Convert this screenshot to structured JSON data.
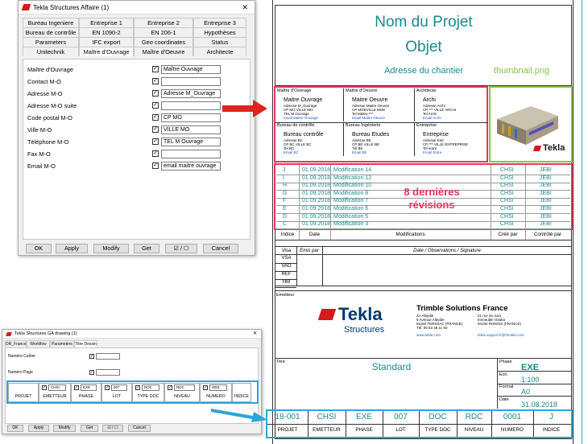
{
  "dialog1": {
    "title": "Tekla Structures  Affaire (1)",
    "close_glyph": "✕",
    "tab_rows": [
      [
        "Bureau Ingeniere",
        "Entreprise 1",
        "Entreprise 2",
        "Entreprise 3"
      ],
      [
        "Bureau de contrôle",
        "EN 1090-2",
        "EN 206-1",
        "Hypothèses"
      ],
      [
        "Parameters",
        "IFC export",
        "Geo coordinates",
        "Status"
      ],
      [
        "Unitechnik",
        "Maître d'Ouvrage",
        "Maître d'Oeuvre",
        "Architecte"
      ]
    ],
    "fields": [
      {
        "label": "Maître d'Ouvrage",
        "checked": true,
        "value": "Maître Ouvrage"
      },
      {
        "label": "Contact M-O",
        "checked": true,
        "value": ""
      },
      {
        "label": "Adresse M-O",
        "checked": true,
        "value": "Adresse M_Ouvrage"
      },
      {
        "label": "Adresse M-O suite",
        "checked": true,
        "value": ""
      },
      {
        "label": "Code postal M-O",
        "checked": true,
        "value": "CP MO"
      },
      {
        "label": "Ville M-O",
        "checked": true,
        "value": "VILLE MO"
      },
      {
        "label": "Téléphone M-O",
        "checked": true,
        "value": "TEL M Ouvrage"
      },
      {
        "label": "Fax M-O",
        "checked": true,
        "value": ""
      },
      {
        "label": "Email M-O",
        "checked": true,
        "value": "email maitre ouvrage"
      }
    ],
    "buttons": {
      "ok": "OK",
      "apply": "Apply",
      "modify": "Modify",
      "get": "Get",
      "toggle": "☑ / ☐",
      "cancel": "Cancel"
    }
  },
  "dialog2": {
    "title": "Tekla Structures  GA drawing (1)",
    "tabs": [
      "DR_France",
      "Workflow",
      "Parameters",
      "Titre Dessin"
    ],
    "fields": [
      {
        "label": "Numéro Cahier",
        "checked": true
      },
      {
        "label": "Numéro Page",
        "checked": true
      }
    ],
    "row_values": [
      "",
      "CHSI",
      "EXE",
      "007",
      "DOC",
      "RDC",
      "0001",
      ""
    ],
    "row_labels": [
      "PROJET",
      "EMETTEUR",
      "PHASE",
      "LOT",
      "TYPE DOC",
      "NIVEAU",
      "NUMERO",
      "INDICE"
    ],
    "buttons": {
      "ok": "OK",
      "apply": "Apply",
      "modify": "Modify",
      "get": "Get",
      "toggle": "☑ / ☐",
      "cancel": "Cancel"
    }
  },
  "titleblock": {
    "project_name": "Nom du Projet",
    "object": "Objet",
    "site_address": "Adresse du chantier",
    "thumbnail_label": "thumbnail.png",
    "parties": [
      {
        "header": "Maître d'Ouvrage",
        "name": "Maitre Ouvrage",
        "lines": [
          "Adresse M_Ouvrage",
          "CP MO  VILLE MO",
          "TEL M Ouvrage"
        ],
        "email": "email Maitre Ouvrage"
      },
      {
        "header": "Maître d'Oeuvre",
        "name": "Maitre Oeuvre",
        "lines": [
          "Adresse Maitre Oeuvre",
          "CP MOEVILLE MOE",
          "Tel Maitre ***"
        ],
        "email": "Email Maitre Oeuvre"
      },
      {
        "header": "Architecte",
        "name": "Archi",
        "lines": [
          "Adresse Archi",
          "CP ***     VILLE ARCHI",
          "Tel Archi"
        ],
        "email": "Email Archi"
      },
      {
        "header": "Bureau de contrôle",
        "name": "Bureau contrôle",
        "lines": [
          "Adresse BC",
          "CP BC    VILLE BC",
          "Tel BC"
        ],
        "email": "Email BC"
      },
      {
        "header": "Bureau Ingénierie",
        "name": "Bureau Etudes",
        "lines": [
          "Adresse BE",
          "CP BE     VILLE BE",
          "Tél BE"
        ],
        "email": "Email BE"
      },
      {
        "header": "Entreprise",
        "name": "Entreprise",
        "lines": [
          "Adresse Entr",
          "CP ***     VILLE ENTREPRISE",
          "Tel entre"
        ],
        "email": "Email Entre"
      }
    ],
    "revisions": [
      {
        "index": "J",
        "date": "01.09.2018",
        "mod": "Modification 14",
        "by": "CHSI",
        "check": "JEBI"
      },
      {
        "index": "I",
        "date": "01.09.2018",
        "mod": "Modification 12",
        "by": "CHSI",
        "check": "JEBI"
      },
      {
        "index": "H",
        "date": "01.09.2018",
        "mod": "Modification 10",
        "by": "CHSI",
        "check": "JEBI"
      },
      {
        "index": "G",
        "date": "01.09.2018",
        "mod": "Modification 8",
        "by": "CHSI",
        "check": "JEBI"
      },
      {
        "index": "F",
        "date": "01.09.2018",
        "mod": "Modification 7",
        "by": "CHSI",
        "check": "JEBI"
      },
      {
        "index": "E",
        "date": "01.09.2018",
        "mod": "Modification 6",
        "by": "CHSI",
        "check": "JEBI"
      },
      {
        "index": "D",
        "date": "01.09.2018",
        "mod": "Modification 5",
        "by": "CHSI",
        "check": "JEBI"
      },
      {
        "index": "C",
        "date": "01.09.2018",
        "mod": "Modification 3",
        "by": "CHSI",
        "check": "JEBI"
      }
    ],
    "revisions_overlay": [
      "8 dernières",
      "révisions"
    ],
    "rev_headers": [
      "Indice",
      "Date",
      "Modifications",
      "Créé par",
      "Contrôlé par"
    ],
    "visa_headers": [
      "Visa",
      "Emis par",
      "Date / Observations / Signature"
    ],
    "visa_rows": [
      "VSA",
      "VAO",
      "REF",
      "HM"
    ],
    "emetteur_label": "Emetteur",
    "company": "Trimble Solutions France",
    "company_addr_left": [
      "ZA Albydie",
      "8 Avenue Albydie",
      "81150 TERSSAC (FRANCE)",
      "Tél: 05 63 48 11 60"
    ],
    "company_web": "www.tekla.com",
    "company_addr_right": [
      "21 rue du Jura",
      "Immeuble Osaka",
      "94150 RUNGIS (FRANCE)"
    ],
    "company_mail": "tekla.support.fr@trimble.com",
    "logo_text": "Tekla",
    "logo_sub": "Structures",
    "titre_label": "Titre",
    "titre_value": "Standard",
    "side": [
      {
        "label": "Phase",
        "value": "EXE"
      },
      {
        "label": "Ech.",
        "value": "1:100"
      },
      {
        "label": "Format",
        "value": "A0"
      },
      {
        "label": "Date",
        "value": "31.08.2018"
      }
    ],
    "code_values": [
      "18-001",
      "CHSI",
      "EXE",
      "007",
      "DOC",
      "RDC",
      "0001",
      "J"
    ],
    "code_labels": [
      "PROJET",
      "EMETTEUR",
      "PHASE",
      "LOT",
      "TYPE DOC",
      "NIVEAU",
      "NUMERO",
      "INDICE"
    ]
  },
  "colors": {
    "teal": "#1b8a8a",
    "red_frame": "#e8365d",
    "green_frame": "#8cc04b",
    "blue_frame": "#2aa6d8",
    "tekla_red": "#d71920",
    "arrow_red": "#e0231c"
  }
}
